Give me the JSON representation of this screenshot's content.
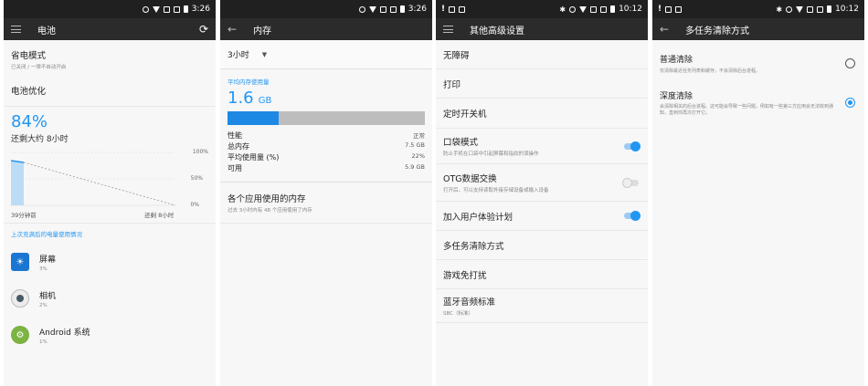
{
  "panel1": {
    "status_time": "3:26",
    "title": "电池",
    "power_saving": {
      "title": "省电模式",
      "subtitle": "已关闭 / 一律不自动开启"
    },
    "battery_opt": {
      "title": "电池优化"
    },
    "percent": "84%",
    "remaining": "还剩大约 8小时",
    "chart_labels": {
      "p100": "100%",
      "p50": "50%",
      "p0": "0%",
      "left": "39分钟前",
      "right": "还剩 8小时"
    },
    "usage_header": "上次充满后的电量使用情况",
    "apps": [
      {
        "name": "屏幕",
        "pct": "3%",
        "color": "#1976d2"
      },
      {
        "name": "相机",
        "pct": "2%",
        "color": "#455a64"
      },
      {
        "name": "Android 系统",
        "pct": "1%",
        "color": "#7cb342"
      }
    ]
  },
  "panel2": {
    "status_time": "3:26",
    "title": "内存",
    "range": "3小时",
    "avg_label": "平均内存使用量",
    "avg_value": "1.6",
    "avg_unit": "GB",
    "usage_fraction": 0.26,
    "stats": [
      {
        "label": "性能",
        "value": "正常"
      },
      {
        "label": "总内存",
        "value": "7.5 GB"
      },
      {
        "label": "平均使用量 (%)",
        "value": "22%"
      },
      {
        "label": "可用",
        "value": "5.9 GB"
      }
    ],
    "apps_memory": {
      "title": "各个应用使用的内存",
      "subtitle": "过去 3小时内有 48 个应用使用了内存"
    }
  },
  "panel3": {
    "status_time": "10:12",
    "title": "其他高级设置",
    "items": [
      {
        "title": "无障碍"
      },
      {
        "title": "打印"
      },
      {
        "title": "定时开关机"
      },
      {
        "title": "口袋模式",
        "subtitle": "防止手机在口袋中引起屏幕和指纹的误操作",
        "toggle": true
      },
      {
        "title": "OTG数据交换",
        "subtitle": "打开后，可以支持读取外接存储设备或输入设备",
        "toggle": false
      },
      {
        "title": "加入用户体验计划",
        "toggle": true
      },
      {
        "title": "多任务清除方式"
      },
      {
        "title": "游戏免打扰"
      },
      {
        "title": "蓝牙音频标准",
        "subtitle": "SBC（标准）"
      }
    ]
  },
  "panel4": {
    "status_time": "10:12",
    "title": "多任务清除方式",
    "options": [
      {
        "title": "普通清除",
        "subtitle": "仅清除最近任务列表和缓存，不会清除后台进程。",
        "selected": false
      },
      {
        "title": "深度清除",
        "subtitle": "会清除相关的后台进程。这可能会导致一些问题，例如有一些第三方应用会无法收到通知，直到你再次打开它。",
        "selected": true
      }
    ]
  }
}
